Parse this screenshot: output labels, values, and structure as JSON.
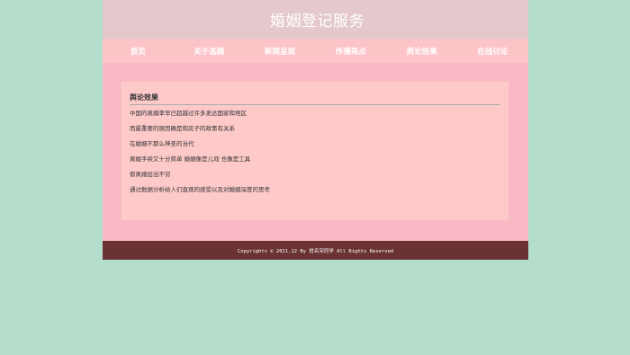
{
  "header": {
    "title": "婚姻登记服务"
  },
  "nav": {
    "items": [
      {
        "label": "首页"
      },
      {
        "label": "关于选题"
      },
      {
        "label": "新闻呈现"
      },
      {
        "label": "传播亮点"
      },
      {
        "label": "舆论效果"
      },
      {
        "label": "在线讨论"
      }
    ]
  },
  "main": {
    "section_title": "舆论效果",
    "articles": [
      {
        "title": "中国的离婚率早已超越过许多发达国家和地区"
      },
      {
        "title": "而最重要的原因确是和房子的政策有关系"
      },
      {
        "title": "在婚姻不那么神圣的当代"
      },
      {
        "title": "离婚手续又十分简单 婚姻像是儿戏 也像是工具"
      },
      {
        "title": "假离婚层出不穷"
      },
      {
        "title": "通过数据分析给人们直观的感受以及对婚姻深度的思考"
      }
    ]
  },
  "footer": {
    "copyright": "Copyrights © 2021.12 By 姓名宋同学 All Rights Reserved"
  },
  "colors": {
    "background": "#b5ddcc",
    "page": "#f9b9c4",
    "header": "#e4c8cb",
    "nav": "#fdc4c8",
    "content": "#fdcac9",
    "footer": "#6a3232"
  }
}
